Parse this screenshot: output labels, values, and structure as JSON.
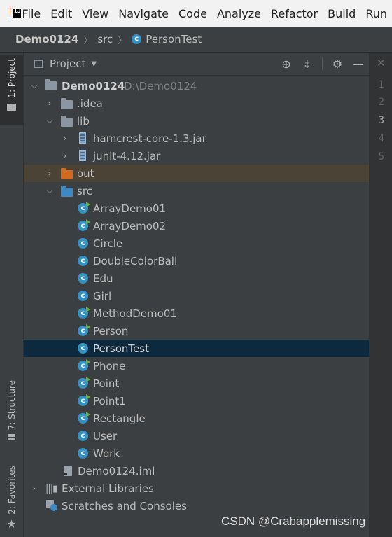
{
  "menubar": {
    "logo_text": "IJ",
    "items": [
      "File",
      "Edit",
      "View",
      "Navigate",
      "Code",
      "Analyze",
      "Refactor",
      "Build",
      "Run"
    ]
  },
  "breadcrumb": {
    "project": "Demo0124",
    "folder": "src",
    "class_name": "PersonTest",
    "separator": "〉"
  },
  "left_strip": {
    "project_tab": "1: Project",
    "structure_tab": "7: Structure",
    "favorites_tab": "2: Favorites"
  },
  "project_panel": {
    "title": "Project",
    "dropdown_icon": "triangle-down-icon",
    "header_icons": [
      "locate-icon",
      "collapse-all-icon",
      "gear-icon",
      "hide-icon"
    ]
  },
  "tree": {
    "root": {
      "label": "Demo0124",
      "path": "D:\\Demo0124"
    },
    "idea": ".idea",
    "lib": "lib",
    "jar1": "hamcrest-core-1.3.jar",
    "jar2": "junit-4.12.jar",
    "out": "out",
    "src": "src",
    "classes": [
      {
        "name": "ArrayDemo01",
        "run": true
      },
      {
        "name": "ArrayDemo02",
        "run": true
      },
      {
        "name": "Circle",
        "run": false
      },
      {
        "name": "DoubleColorBall",
        "run": false
      },
      {
        "name": "Edu",
        "run": false
      },
      {
        "name": "Girl",
        "run": false
      },
      {
        "name": "MethodDemo01",
        "run": true
      },
      {
        "name": "Person",
        "run": true
      },
      {
        "name": "PersonTest",
        "run": false,
        "selected": true
      },
      {
        "name": "Phone",
        "run": true
      },
      {
        "name": "Point",
        "run": true
      },
      {
        "name": "Point1",
        "run": true
      },
      {
        "name": "Rectangle",
        "run": true
      },
      {
        "name": "User",
        "run": false
      },
      {
        "name": "Work",
        "run": false
      }
    ],
    "iml": "Demo0124.iml",
    "external_libraries": "External Libraries",
    "scratches": "Scratches and Consoles"
  },
  "editor": {
    "line_numbers": [
      "1",
      "2",
      "3",
      "4",
      "5"
    ],
    "current_line": "3",
    "close_icon": "close-icon"
  },
  "watermark": "CSDN @Crabapplemissing",
  "colors": {
    "selection": "#0d293e",
    "excluded_folder": "#4a4336",
    "class_icon": "#3592c4",
    "run_marker": "#62b543"
  }
}
